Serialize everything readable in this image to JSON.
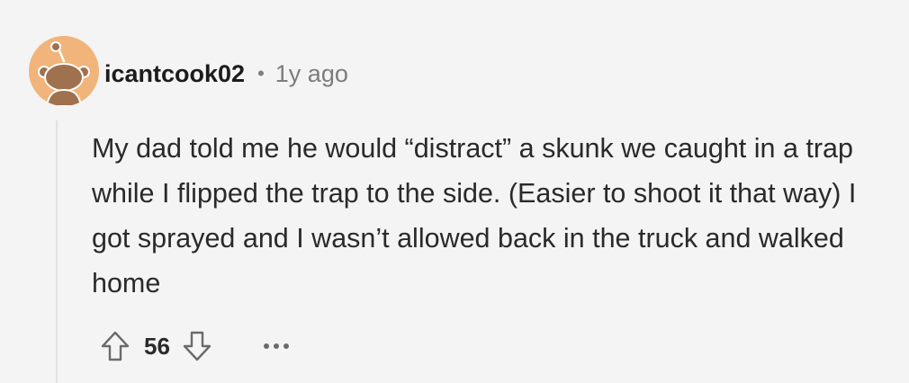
{
  "comment": {
    "username": "icantcook02",
    "separator": "•",
    "time": "1y ago",
    "body": "My dad told me he would “distract” a skunk we caught in a trap while I flipped the trap to the side. (Easier to shoot it that way) I got sprayed and I wasn’t allowed back in the truck and walked home",
    "score": "56",
    "avatar_color": "#f1b47a",
    "more_label": "•••"
  },
  "icons": {
    "upvote": "arrow-up-outline-icon",
    "downvote": "arrow-down-outline-icon",
    "more": "more-horizontal-icon",
    "avatar": "reddit-snoo-avatar-icon"
  }
}
